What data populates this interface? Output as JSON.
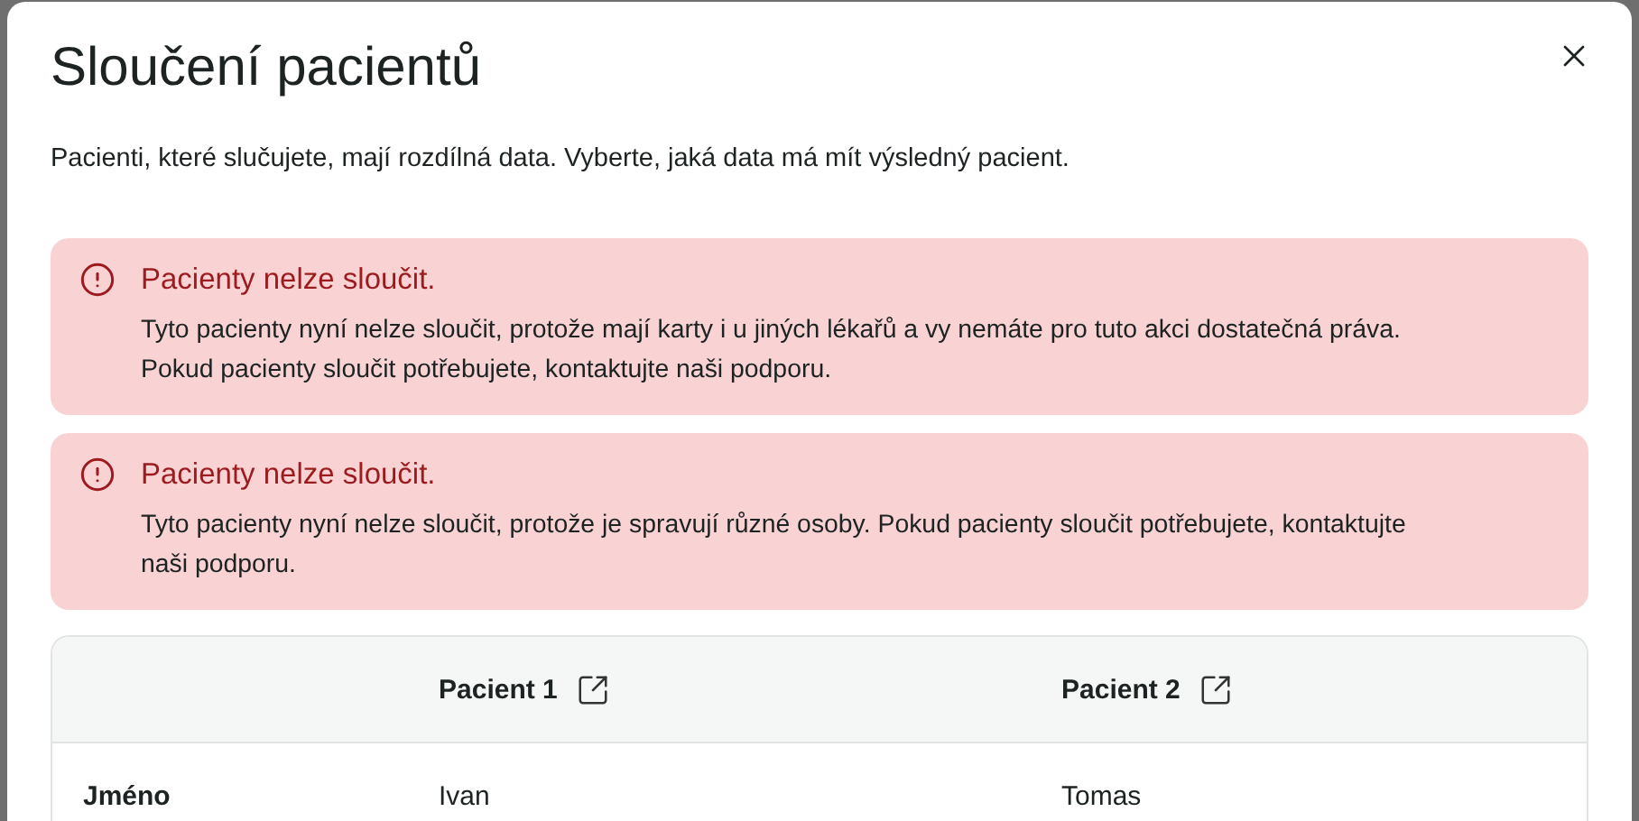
{
  "dialog": {
    "title": "Sloučení pacientů",
    "description": "Pacienti, které slučujete, mají rozdílná data. Vyberte, jaká data má mít výsledný pacient."
  },
  "alerts": [
    {
      "kind": "error",
      "title": "Pacienty nelze sloučit.",
      "message": "Tyto pacienty nyní nelze sloučit, protože mají karty i u jiných lékařů a vy nemáte pro tuto akci dostatečná práva. Pokud pacienty sloučit potřebujete, kontaktujte naši podporu."
    },
    {
      "kind": "error",
      "title": "Pacienty nelze sloučit.",
      "message": "Tyto pacienty nyní nelze sloučit, protože je spravují různé osoby. Pokud pacienty sloučit potřebujete, kontaktujte naši podporu."
    }
  ],
  "table": {
    "columns": [
      "Pacient 1",
      "Pacient 2"
    ],
    "rows": [
      {
        "label": "Jméno",
        "values": [
          "Ivan",
          "Tomas"
        ]
      }
    ]
  }
}
